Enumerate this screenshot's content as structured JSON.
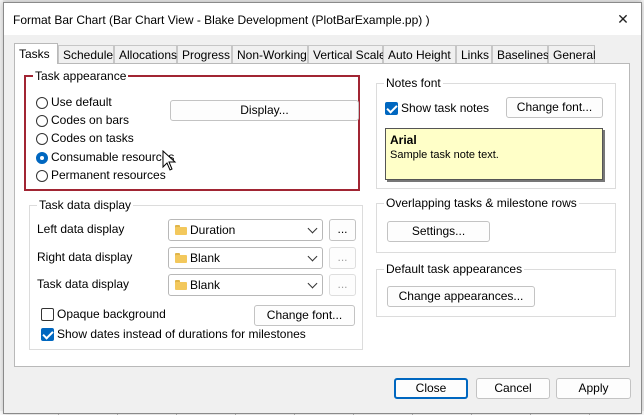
{
  "window": {
    "title": "Format Bar Chart (Bar Chart View - Blake Development (PlotBarExample.pp) )",
    "close_glyph": "✕"
  },
  "tabs": [
    {
      "label": "Tasks",
      "active": true
    },
    {
      "label": "Schedule"
    },
    {
      "label": "Allocations"
    },
    {
      "label": "Progress"
    },
    {
      "label": "Non-Working"
    },
    {
      "label": "Vertical Scale"
    },
    {
      "label": "Auto Height"
    },
    {
      "label": "Links"
    },
    {
      "label": "Baselines"
    },
    {
      "label": "General"
    }
  ],
  "task_appearance": {
    "legend": "Task appearance",
    "options": [
      {
        "label": "Use default",
        "checked": false
      },
      {
        "label": "Codes on bars",
        "checked": false
      },
      {
        "label": "Codes on tasks",
        "checked": false
      },
      {
        "label": "Consumable resources",
        "checked": true
      },
      {
        "label": "Permanent resources",
        "checked": false
      }
    ],
    "display_button": "Display...",
    "highlight_color": "#a12533"
  },
  "notes_font": {
    "legend": "Notes font",
    "show_task_notes": {
      "label": "Show task notes",
      "checked": true
    },
    "change_font_button": "Change font...",
    "sample_title": "Arial",
    "sample_text": "Sample task note text."
  },
  "task_data_display": {
    "legend": "Task data display",
    "rows": [
      {
        "label": "Left data display",
        "value": "Duration",
        "more": "...",
        "more_enabled": true
      },
      {
        "label": "Right data display",
        "value": "Blank",
        "more": "...",
        "more_enabled": false
      },
      {
        "label": "Task data display",
        "value": "Blank",
        "more": "...",
        "more_enabled": false
      }
    ],
    "opaque_background": {
      "label": "Opaque background",
      "checked": false
    },
    "change_font_button": "Change font...",
    "show_dates": {
      "label": "Show dates instead of durations for milestones",
      "checked": true
    }
  },
  "overlapping": {
    "legend": "Overlapping tasks & milestone rows",
    "settings_button": "Settings..."
  },
  "default_appearances": {
    "legend": "Default task appearances",
    "change_button": "Change appearances..."
  },
  "footer": {
    "close": "Close",
    "cancel": "Cancel",
    "apply": "Apply"
  },
  "colors": {
    "accent": "#0067c0",
    "note_bg": "#ffffc8"
  }
}
